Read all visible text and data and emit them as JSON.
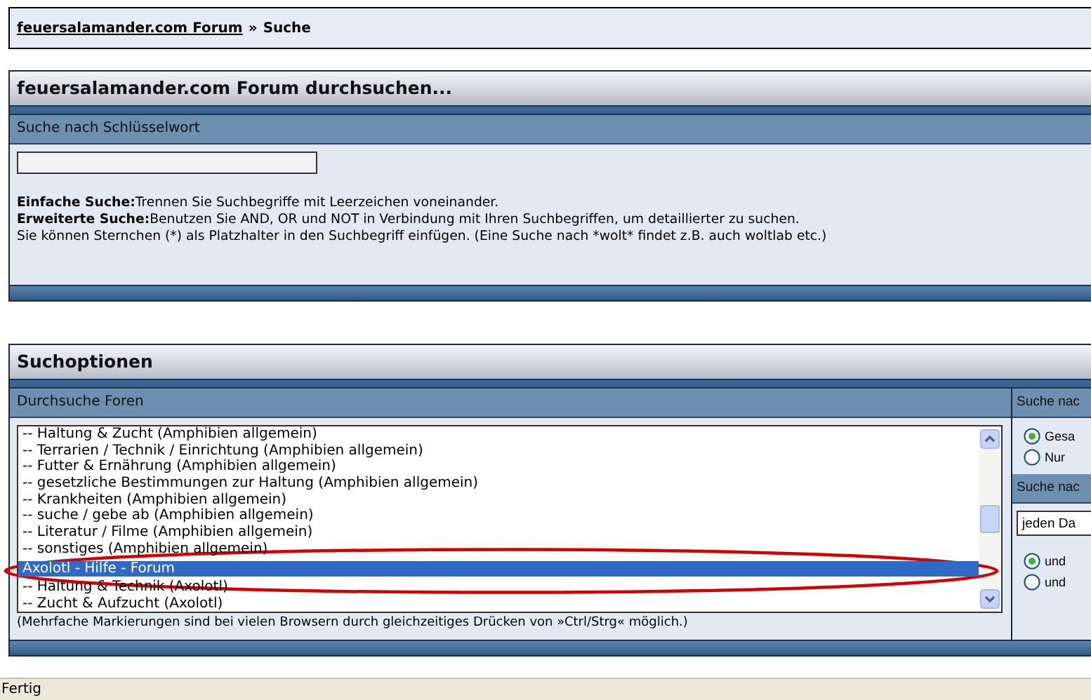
{
  "breadcrumb": {
    "link": "feuersalamander.com Forum",
    "separator": "»",
    "current": "Suche"
  },
  "search_panel": {
    "title": "feuersalamander.com Forum durchsuchen...",
    "subheader": "Suche nach Schlüsselwort",
    "help": [
      {
        "term": "Einfache Suche:",
        "text": "Trennen Sie Suchbegriffe mit Leerzeichen voneinander."
      },
      {
        "term": "Erweiterte Suche:",
        "text": "Benutzen Sie AND, OR und NOT in Verbindung mit Ihren Suchbegriffen, um detaillierter zu suchen."
      },
      {
        "text": "Sie können Sternchen (*) als Platzhalter in den Suchbegriff einfügen. (Eine Suche nach *wolt* findet z.B. auch woltlab etc.)"
      }
    ]
  },
  "options_panel": {
    "title": "Suchoptionen",
    "forums": {
      "subheader": "Durchsuche Foren",
      "items": [
        {
          "label": "-- Haltung & Zucht (Amphibien allgemein)",
          "selected": false
        },
        {
          "label": "-- Terrarien / Technik / Einrichtung (Amphibien allgemein)",
          "selected": false
        },
        {
          "label": "-- Futter & Ernährung (Amphibien allgemein)",
          "selected": false
        },
        {
          "label": "-- gesetzliche Bestimmungen zur Haltung (Amphibien allgemein)",
          "selected": false
        },
        {
          "label": "-- Krankheiten (Amphibien allgemein)",
          "selected": false
        },
        {
          "label": "-- suche / gebe ab (Amphibien allgemein)",
          "selected": false
        },
        {
          "label": "-- Literatur / Filme (Amphibien allgemein)",
          "selected": false
        },
        {
          "label": "-- sonstiges (Amphibien allgemein)",
          "selected": false
        },
        {
          "label": "Axolotl - Hilfe - Forum",
          "selected": true
        },
        {
          "label": "-- Haltung & Technik (Axolotl)",
          "selected": false
        },
        {
          "label": "-- Zucht & Aufzucht (Axolotl)",
          "selected": false
        }
      ],
      "note": "(Mehrfache Markierungen sind bei vielen Browsern durch gleichzeitiges Drücken von »Ctrl/Strg« möglich.)"
    },
    "side_sections": [
      {
        "subheader": "Suche nac",
        "radios": [
          {
            "label": "Gesa",
            "selected": true
          },
          {
            "label": "Nur",
            "selected": false
          }
        ]
      },
      {
        "subheader": "Suche nac",
        "select": "jeden Da",
        "radios": [
          {
            "label": "und",
            "selected": true
          },
          {
            "label": "und",
            "selected": false
          }
        ]
      }
    ]
  },
  "status_bar": "Fertig"
}
